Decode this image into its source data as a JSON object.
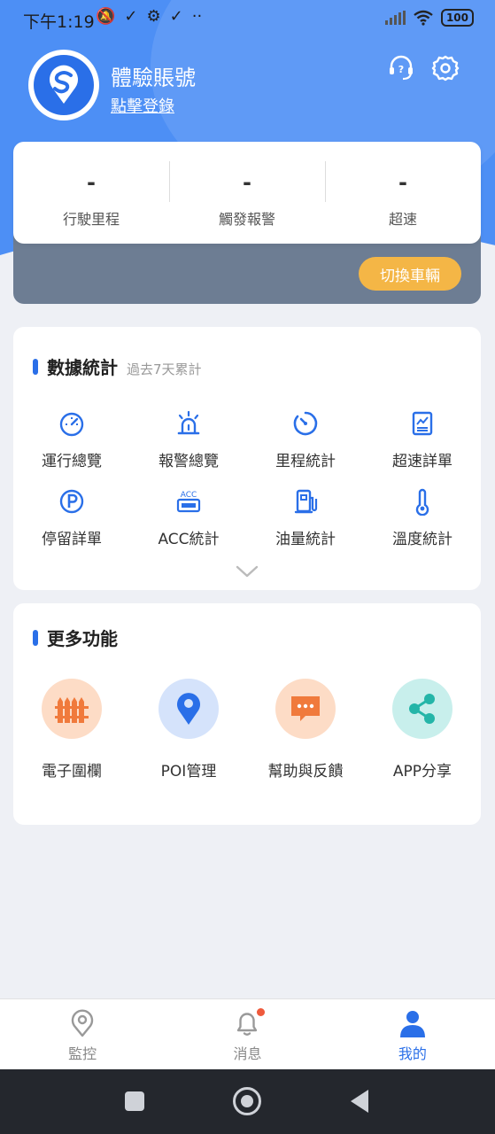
{
  "status_bar": {
    "time": "下午1:19",
    "battery": "100"
  },
  "profile": {
    "name": "體驗賬號",
    "login_link": "點擊登錄"
  },
  "summary": {
    "stats": [
      {
        "value": "-",
        "label": "行駛里程"
      },
      {
        "value": "-",
        "label": "觸發報警"
      },
      {
        "value": "-",
        "label": "超速"
      }
    ],
    "switch_vehicle": "切換車輛"
  },
  "data_stats": {
    "title": "數據統計",
    "subtitle": "過去7天累計",
    "items": [
      {
        "label": "運行總覽",
        "icon": "speedometer-icon"
      },
      {
        "label": "報警總覽",
        "icon": "alarm-light-icon"
      },
      {
        "label": "里程統計",
        "icon": "odometer-icon"
      },
      {
        "label": "超速詳單",
        "icon": "speed-report-icon"
      },
      {
        "label": "停留詳單",
        "icon": "parking-icon"
      },
      {
        "label": "ACC統計",
        "icon": "acc-icon"
      },
      {
        "label": "油量統計",
        "icon": "fuel-pump-icon"
      },
      {
        "label": "溫度統計",
        "icon": "thermometer-icon"
      }
    ],
    "acc_icon_text": "ACC"
  },
  "more_functions": {
    "title": "更多功能",
    "items": [
      {
        "label": "電子圍欄",
        "icon": "fence-icon",
        "bg": "#fddcc6"
      },
      {
        "label": "POI管理",
        "icon": "location-pin-icon",
        "bg": "#d5e3fb"
      },
      {
        "label": "幫助與反饋",
        "icon": "chat-bubble-icon",
        "bg": "#fddcc6"
      },
      {
        "label": "APP分享",
        "icon": "share-icon",
        "bg": "#c8efec"
      }
    ]
  },
  "tabs": [
    {
      "label": "監控",
      "active": false
    },
    {
      "label": "消息",
      "active": false
    },
    {
      "label": "我的",
      "active": true
    }
  ],
  "colors": {
    "primary": "#2a6fe8",
    "accent": "#f4b646",
    "orange": "#f07a3c",
    "teal": "#24b5a8"
  }
}
